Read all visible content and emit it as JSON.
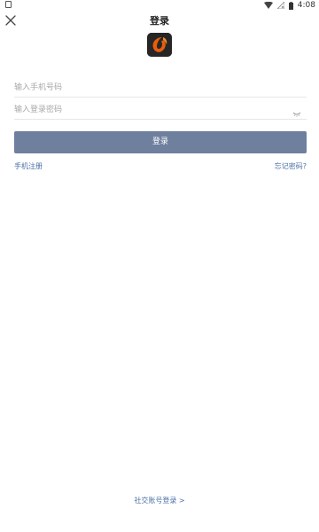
{
  "status_bar": {
    "time": "4:08"
  },
  "header": {
    "title": "登录"
  },
  "form": {
    "phone_placeholder": "输入手机号码",
    "password_placeholder": "输入登录密码",
    "login_label": "登录"
  },
  "links": {
    "register": "手机注册",
    "forgot_password": "忘记密码?",
    "social_login": "社交账号登录 >"
  },
  "colors": {
    "login_button": "#6f7f9e",
    "link": "#4a6fa5"
  },
  "icons": {
    "close": "close-icon",
    "logo": "app-logo-icon",
    "password_toggle": "eye-closed-icon"
  }
}
